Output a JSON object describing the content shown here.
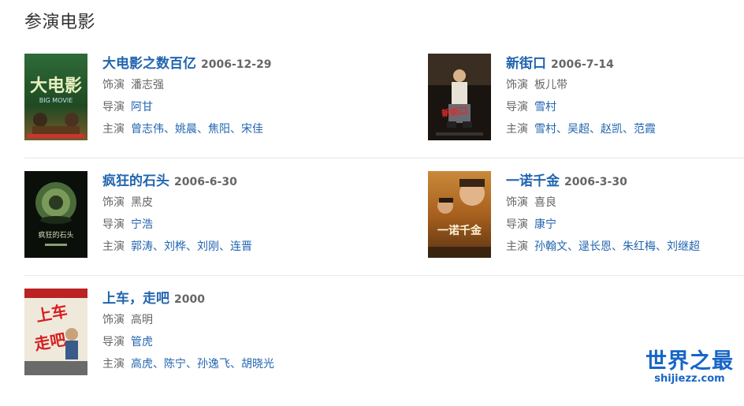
{
  "section": {
    "title": "参演电影"
  },
  "labels": {
    "role": "饰演",
    "director": "导演",
    "cast": "主演"
  },
  "films": [
    {
      "title": "大电影之数百亿",
      "date": "2006-12-29",
      "role": "潘志强",
      "directors": [
        "阿甘"
      ],
      "cast": [
        "曾志伟",
        "姚晨",
        "焦阳",
        "宋佳"
      ],
      "poster_icon": "poster-big-movie-icon"
    },
    {
      "title": "新街口",
      "date": "2006-7-14",
      "role": "板儿带",
      "directors": [
        "雪村"
      ],
      "cast": [
        "雪村",
        "吴超",
        "赵凯",
        "范霞"
      ],
      "poster_icon": "poster-xinjiekou-icon"
    },
    {
      "title": "疯狂的石头",
      "date": "2006-6-30",
      "role": "黑皮",
      "directors": [
        "宁浩"
      ],
      "cast": [
        "郭涛",
        "刘桦",
        "刘刚",
        "连晋"
      ],
      "poster_icon": "poster-crazy-stone-icon"
    },
    {
      "title": "一诺千金",
      "date": "2006-3-30",
      "role": "喜良",
      "directors": [
        "康宁"
      ],
      "cast": [
        "孙翰文",
        "逯长恩",
        "朱红梅",
        "刘继超"
      ],
      "poster_icon": "poster-promise-icon"
    },
    {
      "title": "上车，走吧",
      "date": "2000",
      "role": "高明",
      "directors": [
        "管虎"
      ],
      "cast": [
        "高虎",
        "陈宁",
        "孙逸飞",
        "胡晓光"
      ],
      "poster_icon": "poster-get-on-bus-icon"
    }
  ],
  "watermark": {
    "main": "世界之最",
    "sub": "shijiezz.com"
  },
  "colors": {
    "link": "#2165af",
    "label": "#666666",
    "divider": "#e8e8e8",
    "watermark": "#1766c6"
  }
}
